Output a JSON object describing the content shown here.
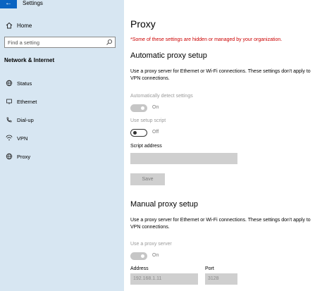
{
  "window": {
    "title": "Settings"
  },
  "sidebar": {
    "home_label": "Home",
    "search_placeholder": "Find a setting",
    "section_title": "Network & Internet",
    "items": [
      {
        "label": "Status",
        "icon": "globe-icon"
      },
      {
        "label": "Ethernet",
        "icon": "ethernet-icon"
      },
      {
        "label": "Dial-up",
        "icon": "phone-icon"
      },
      {
        "label": "VPN",
        "icon": "vpn-icon"
      },
      {
        "label": "Proxy",
        "icon": "globe-icon"
      }
    ]
  },
  "main": {
    "title": "Proxy",
    "warning": "*Some of these settings are hidden or managed by your organization.",
    "auto": {
      "heading": "Automatic proxy setup",
      "description": "Use a proxy server for Ethernet or Wi-Fi connections. These settings don't apply to VPN connections.",
      "detect_label": "Automatically detect settings",
      "detect_state": "On",
      "script_label": "Use setup script",
      "script_state": "Off",
      "address_label": "Script address",
      "address_value": "",
      "save_label": "Save"
    },
    "manual": {
      "heading": "Manual proxy setup",
      "description": "Use a proxy server for Ethernet or Wi-Fi connections. These settings don't apply to VPN connections.",
      "use_label": "Use a proxy server",
      "use_state": "On",
      "address_label": "Address",
      "address_value": "192.168.1.11",
      "port_label": "Port",
      "port_value": "3128"
    }
  },
  "colors": {
    "sidebar_bg": "#d7e6f2",
    "accent": "#0a64c2",
    "warning": "#cc0000"
  }
}
